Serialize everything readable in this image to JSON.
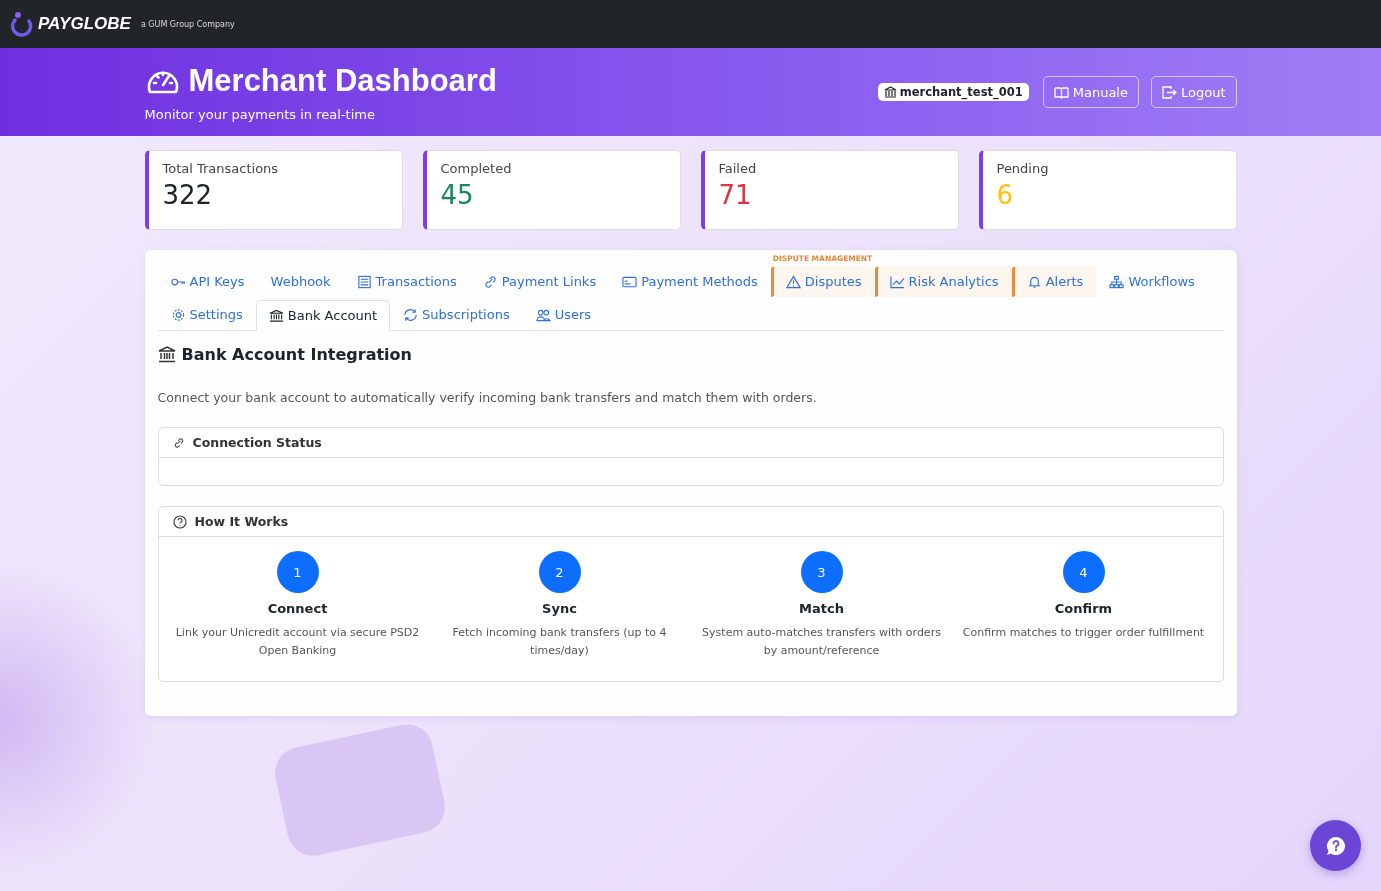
{
  "topbar": {
    "brand": "PAYGLOBE",
    "tagline": "a GUM Group Company"
  },
  "header": {
    "title": "Merchant Dashboard",
    "subtitle": "Monitor your payments in real-time",
    "merchant": "merchant_test_001",
    "buttons": [
      {
        "label": "Manuale",
        "kind": "book"
      },
      {
        "label": "Logout",
        "kind": "logout"
      }
    ]
  },
  "stats": [
    {
      "label": "Total Transactions",
      "value": "322",
      "color": "#212529"
    },
    {
      "label": "Completed",
      "value": "45",
      "color": "#198754"
    },
    {
      "label": "Failed",
      "value": "71",
      "color": "#dc3545"
    },
    {
      "label": "Pending",
      "value": "6",
      "color": "#ffc107"
    }
  ],
  "tabs": {
    "group_label": "DISPUTE MANAGEMENT",
    "rows": [
      [
        {
          "label": "API Keys",
          "kind": "key",
          "selected": false,
          "highlighted": false
        },
        {
          "label": "Webhook",
          "kind": "plain",
          "selected": false,
          "highlighted": false
        },
        {
          "label": "Transactions",
          "kind": "list",
          "selected": false,
          "highlighted": false
        },
        {
          "label": "Payment Links",
          "kind": "link",
          "selected": false,
          "highlighted": false
        },
        {
          "label": "Payment Methods",
          "kind": "card",
          "selected": false,
          "highlighted": false
        },
        {
          "label": "Disputes",
          "kind": "warning",
          "selected": false,
          "highlighted": true
        },
        {
          "label": "Risk Analytics",
          "kind": "chart",
          "selected": false,
          "highlighted": true
        },
        {
          "label": "Alerts",
          "kind": "bell",
          "selected": false,
          "highlighted": true
        },
        {
          "label": "Workflows",
          "kind": "flow",
          "selected": false,
          "highlighted": false
        }
      ],
      [
        {
          "label": "Settings",
          "kind": "gear",
          "selected": false,
          "highlighted": false
        },
        {
          "label": "Bank Account",
          "kind": "bank",
          "selected": true,
          "highlighted": false
        },
        {
          "label": "Subscriptions",
          "kind": "refresh",
          "selected": false,
          "highlighted": false
        },
        {
          "label": "Users",
          "kind": "users",
          "selected": false,
          "highlighted": false
        }
      ]
    ]
  },
  "section": {
    "title": "Bank Account Integration",
    "description": "Connect your bank account to automatically verify incoming bank transfers and match them with orders."
  },
  "connection_panel": {
    "title": "Connection Status"
  },
  "how_panel": {
    "title": "How It Works",
    "steps": [
      {
        "number": "1",
        "title": "Connect",
        "text": "Link your Unicredit account via secure PSD2 Open Banking"
      },
      {
        "number": "2",
        "title": "Sync",
        "text": "Fetch incoming bank transfers (up to 4 times/day)"
      },
      {
        "number": "3",
        "title": "Match",
        "text": "System auto-matches transfers with orders by amount/reference"
      },
      {
        "number": "4",
        "title": "Confirm",
        "text": "Confirm matches to trigger order fulfillment"
      }
    ]
  }
}
